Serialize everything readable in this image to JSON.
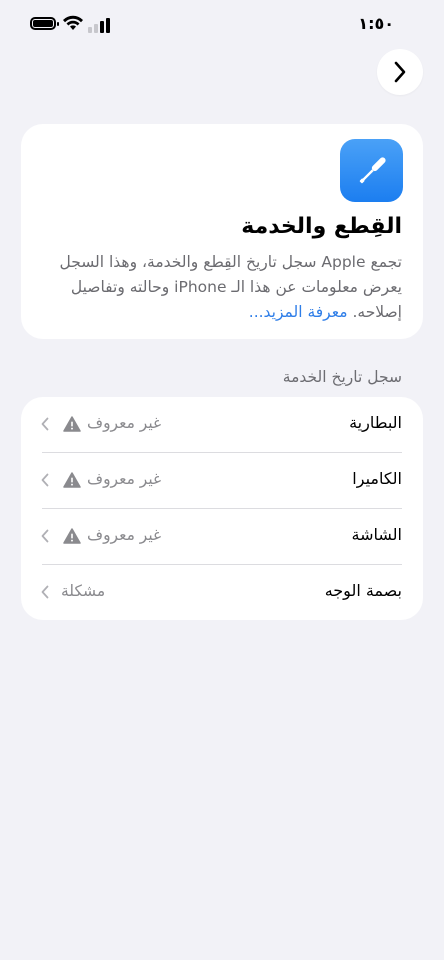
{
  "status_bar": {
    "time": "١:٥٠"
  },
  "card": {
    "title": "القِطع والخدمة",
    "body": "تجمع Apple سجل تاريخ القِطع والخدمة، وهذا السجل يعرض معلومات عن هذا الـ iPhone وحالته وتفاصيل إصلاحه. ",
    "learn_more": "معرفة المزيد..."
  },
  "service_history": {
    "header": "سجل تاريخ الخدمة",
    "rows": [
      {
        "label": "البطارية",
        "status": "غير معروف",
        "icon": "warning-icon"
      },
      {
        "label": "الكاميرا",
        "status": "غير معروف",
        "icon": "warning-icon"
      },
      {
        "label": "الشاشة",
        "status": "غير معروف",
        "icon": "warning-icon"
      },
      {
        "label": "بصمة الوجه",
        "status": "مشكلة"
      }
    ]
  },
  "colors": {
    "accent": "#2f7ee8",
    "background": "#f2f2f7",
    "icon_gradient": "#1c7ef0"
  }
}
